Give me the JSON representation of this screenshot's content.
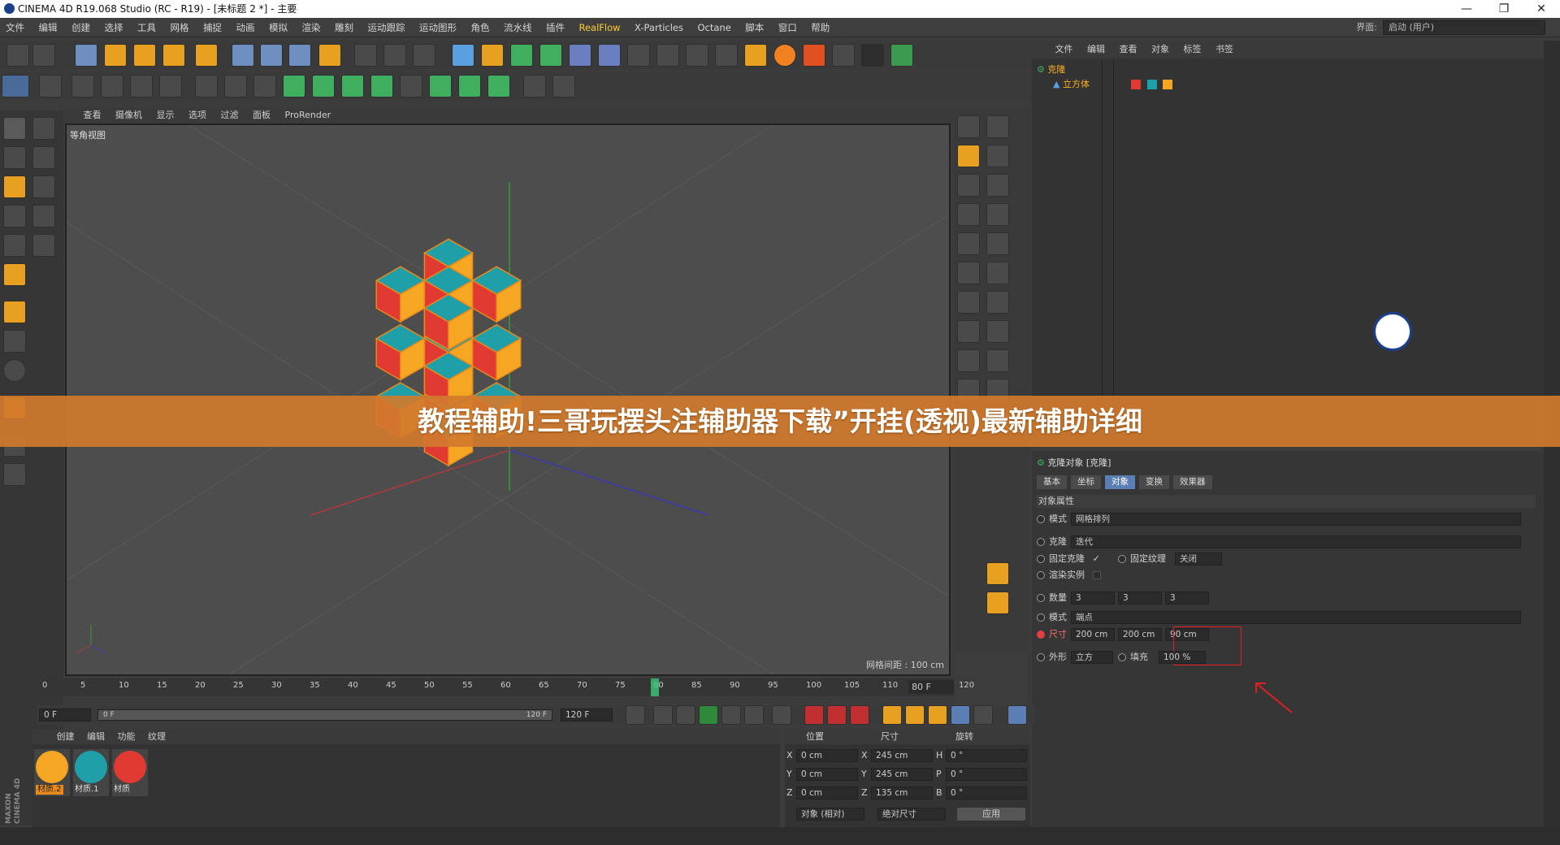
{
  "titlebar": {
    "title": "CINEMA 4D R19.068 Studio (RC - R19) - [未标题 2 *] - 主要",
    "minimize": "—",
    "restore": "❐",
    "close": "✕"
  },
  "menu": [
    "文件",
    "编辑",
    "创建",
    "选择",
    "工具",
    "网格",
    "捕捉",
    "动画",
    "模拟",
    "渲染",
    "雕刻",
    "运动跟踪",
    "运动图形",
    "角色",
    "流水线",
    "插件",
    "RealFlow",
    "X-Particles",
    "Octane",
    "脚本",
    "窗口",
    "帮助"
  ],
  "layout": {
    "label": "界面:",
    "value": "启动 (用户)"
  },
  "viewport": {
    "menu": [
      "查看",
      "摄像机",
      "显示",
      "选项",
      "过滤",
      "面板",
      "ProRender"
    ],
    "name": "等角视图",
    "grid_info": "网格间距 : 100 cm"
  },
  "object_manager": {
    "menu": [
      "文件",
      "编辑",
      "查看",
      "对象",
      "标签",
      "书签"
    ],
    "objects": [
      {
        "name": "克隆"
      },
      {
        "name": "立方体"
      }
    ]
  },
  "banner": {
    "text": "教程辅助!三哥玩摆头注辅助器下载”开挂(透视)最新辅助详细"
  },
  "attributes": {
    "header": "克隆对象 [克隆]",
    "tabs": [
      "基本",
      "坐标",
      "对象",
      "变换",
      "效果器"
    ],
    "active_tab": "对象",
    "section": "对象属性",
    "mode_label": "模式",
    "mode_value": "网格排列",
    "clone_label": "克隆",
    "clone_value": "迭代",
    "fix_clone_label": "固定克隆",
    "fix_clone_checked": "✓",
    "fix_texture_label": "固定纹理",
    "fix_texture_value": "关闭",
    "render_instance_label": "渲染实例",
    "count_label": "数量",
    "count": [
      "3",
      "3",
      "3"
    ],
    "mode2_label": "模式",
    "mode2_value": "端点",
    "size_label": "尺寸",
    "size": [
      "200 cm",
      "200 cm",
      "90 cm"
    ],
    "shape_label": "外形",
    "shape_value": "立方",
    "fill_label": "填充",
    "fill_value": "100 %"
  },
  "timeline": {
    "ticks": [
      "0",
      "5",
      "10",
      "15",
      "20",
      "25",
      "30",
      "35",
      "40",
      "45",
      "50",
      "55",
      "60",
      "65",
      "70",
      "75",
      "80",
      "85",
      "90",
      "95",
      "100",
      "105",
      "110",
      "115",
      "120"
    ],
    "current": "80",
    "current_frame_box": "80 F"
  },
  "transport": {
    "start": "0 F",
    "range_start": "0 F",
    "range_end": "120 F",
    "end": "120 F"
  },
  "materials": {
    "menu": [
      "创建",
      "编辑",
      "功能",
      "纹理"
    ],
    "items": [
      {
        "name": "材质.2",
        "color": "#f5a623"
      },
      {
        "name": "材质.1",
        "color": "#1fa0a8"
      },
      {
        "name": "材质",
        "color": "#e03a32"
      }
    ]
  },
  "coords": {
    "headers": [
      "位置",
      "尺寸",
      "旋转"
    ],
    "rows": [
      {
        "axis": "X",
        "pos": "0 cm",
        "size_axis": "X",
        "size": "245 cm",
        "rot_axis": "H",
        "rot": "0 °"
      },
      {
        "axis": "Y",
        "pos": "0 cm",
        "size_axis": "Y",
        "size": "245 cm",
        "rot_axis": "P",
        "rot": "0 °"
      },
      {
        "axis": "Z",
        "pos": "0 cm",
        "size_axis": "Z",
        "size": "135 cm",
        "rot_axis": "B",
        "rot": "0 °"
      }
    ],
    "mode": "对象 (相对)",
    "size_mode": "绝对尺寸",
    "apply": "应用"
  },
  "maxon": {
    "text": "MAXON CINEMA 4D"
  },
  "colors": {
    "teal": "#1fa0a8",
    "red": "#e03a32",
    "yellow": "#f5a623",
    "orange_outline": "#e8891a",
    "accent": "#5b7fb5",
    "highlight_box": "#e02020"
  }
}
